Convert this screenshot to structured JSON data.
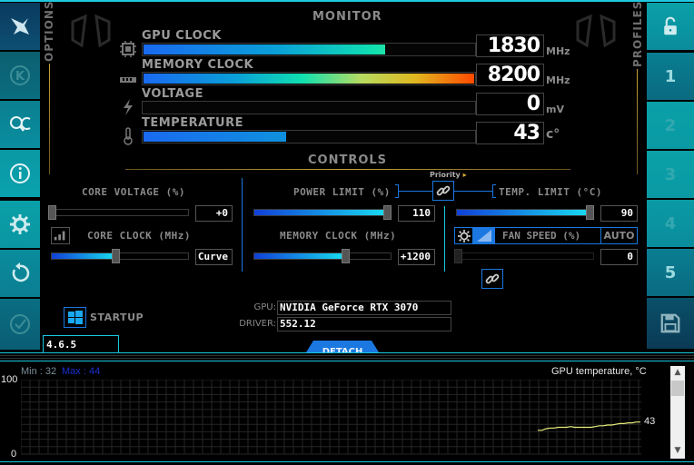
{
  "sidebar_left": {
    "label": "OPTIONS",
    "buttons": [
      {
        "icon": "msi-afterburner-icon",
        "name": "afterburner"
      },
      {
        "icon": "kombustor-k-icon",
        "name": "kombustor"
      },
      {
        "icon": "oc-scanner-icon",
        "name": "oc-scanner"
      },
      {
        "icon": "info-icon",
        "name": "info"
      },
      {
        "icon": "gear-icon",
        "name": "settings"
      },
      {
        "icon": "reset-icon",
        "name": "reset"
      },
      {
        "icon": "apply-check-icon",
        "name": "apply"
      }
    ]
  },
  "sidebar_right": {
    "label": "PROFILES",
    "lock_icon": "unlock-icon",
    "profiles": [
      "1",
      "2",
      "3",
      "4",
      "5"
    ],
    "save_icon": "save-icon"
  },
  "monitor": {
    "title": "MONITOR",
    "rows": [
      {
        "label": "GPU CLOCK",
        "value": "1830",
        "unit": "MHz",
        "fill": 0.73,
        "icon": "chip-icon"
      },
      {
        "label": "MEMORY CLOCK",
        "value": "8200",
        "unit": "MHz",
        "fill": 1.0,
        "icon": "memory-icon"
      },
      {
        "label": "VOLTAGE",
        "value": "0",
        "unit": "mV",
        "fill": 0.0,
        "icon": "lightning-icon"
      },
      {
        "label": "TEMPERATURE",
        "value": "43",
        "unit": "c°",
        "fill": 0.43,
        "icon": "thermometer-icon"
      }
    ]
  },
  "controls": {
    "title": "CONTROLS",
    "priority_label": "Priority",
    "core_voltage": {
      "label": "CORE VOLTAGE (%)",
      "value": "+0",
      "fill": 0.0
    },
    "core_clock": {
      "label": "CORE CLOCK (MHz)",
      "value": "Curve",
      "fill": 0.47
    },
    "power_limit": {
      "label": "POWER LIMIT (%)",
      "value": "110",
      "fill": 1.0
    },
    "memory_clock": {
      "label": "MEMORY CLOCK (MHz)",
      "value": "+1200",
      "fill": 0.68
    },
    "temp_limit": {
      "label": "TEMP. LIMIT (°C)",
      "value": "90",
      "fill": 1.0
    },
    "fan_speed": {
      "label": "FAN SPEED (%)",
      "value": "0",
      "auto_label": "AUTO",
      "fill": 0.0
    }
  },
  "startup": {
    "label": "STARTUP"
  },
  "version": "4.6.5",
  "gpu_info": {
    "gpu_label": "GPU:",
    "gpu_value": "NVIDIA GeForce RTX 3070",
    "driver_label": "DRIVER:",
    "driver_value": "552.12"
  },
  "detach_label": "DETACH",
  "graph": {
    "min_label": "Min : 32",
    "max_label": "Max : 44",
    "title": "GPU temperature, °C",
    "y_top": "100",
    "y_bottom": "0",
    "current_value": "43",
    "line_color": "#e6f07a",
    "chart_data": {
      "type": "line",
      "title": "GPU temperature, °C",
      "ylim": [
        0,
        100
      ],
      "y": [
        32,
        32,
        34,
        35,
        35,
        36,
        36,
        36,
        37,
        36,
        36,
        36,
        36,
        36,
        37,
        38,
        38,
        39,
        39,
        40,
        41,
        41,
        42,
        42,
        43,
        43
      ]
    }
  },
  "colors": {
    "accent_cyan": "#1ec8e0",
    "accent_blue": "#1a78e0",
    "gold": "#c9a53a"
  }
}
